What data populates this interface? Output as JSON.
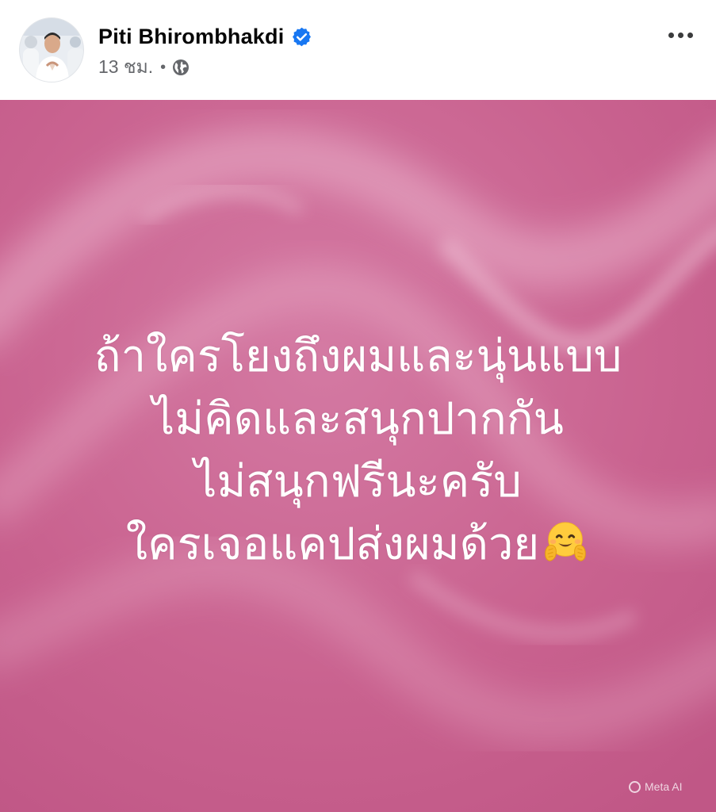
{
  "post": {
    "author": {
      "name": "Piti Bhirombhakdi",
      "verified": true,
      "avatar_icon": "profile-photo"
    },
    "timestamp": "13 ชม.",
    "separator": "•",
    "audience_icon": "globe-icon",
    "more_icon": "more-options-icon",
    "background": {
      "style": "pink-abstract-swirl",
      "color": "#c85f8c"
    },
    "text_lines": [
      "ถ้าใครโยงถึงผมและนุ่นแบบ",
      "ไม่คิดและสนุกปากกัน",
      "ไม่สนุกฟรีนะครับ",
      "ใครเจอแคปส่งผมด้วย"
    ],
    "emoji": "hugging-face",
    "watermark": "Meta AI"
  },
  "colors": {
    "verified_blue": "#1877f2",
    "secondary_text": "#65676b",
    "primary_text": "#050505"
  }
}
